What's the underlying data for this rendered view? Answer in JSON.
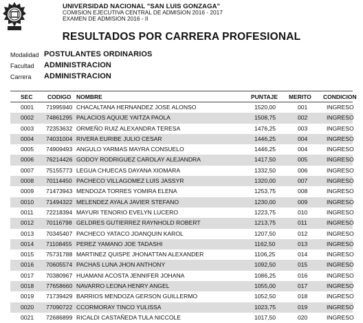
{
  "header": {
    "university": "UNIVERSIDAD NACIONAL \"SAN LUIS GONZAGA\"",
    "commission": "COMISION EJECUTIVA CENTRAL DE ADMISION 2016 - 2017",
    "exam": "EXAMEN DE ADMISION 2016 - II"
  },
  "title": "RESULTADOS POR CARRERA PROFESIONAL",
  "meta": {
    "modalidad_label": "Modalidad",
    "modalidad_value": "POSTULANTES ORDINARIOS",
    "facultad_label": "Facultad",
    "facultad_value": "ADMINISTRACION",
    "carrera_label": "Carrera",
    "carrera_value": "ADMINISTRACION"
  },
  "table": {
    "headers": [
      "SEC",
      "CODIGO",
      "NOMBRE",
      "PUNTAJE",
      "MERITO",
      "CONDICION"
    ],
    "rows": [
      [
        "0001",
        "71995940",
        "CHACALTANA HERNANDEZ JOSE ALONSO",
        "1520,00",
        "001",
        "INGRESO"
      ],
      [
        "0002",
        "74861295",
        "PALACIOS AQUIJE YAITZA PAOLA",
        "1508,75",
        "002",
        "INGRESO"
      ],
      [
        "0003",
        "72353632",
        "ORMEÑO RUIZ ALEXANDRA TERESA",
        "1476,25",
        "003",
        "INGRESO"
      ],
      [
        "0004",
        "74031004",
        "RIVERA EURIBE JULIO CESAR",
        "1446,25",
        "004",
        "INGRESO"
      ],
      [
        "0005",
        "74909493",
        "ANGULO YARMAS  MAYRA CONSUELO",
        "1446,25",
        "004",
        "INGRESO"
      ],
      [
        "0006",
        "76214426",
        "GODOY RODRIGUEZ CAROLAY ALEJANDRA",
        "1417,50",
        "005",
        "INGRESO"
      ],
      [
        "0007",
        "75155773",
        "LEGUA CHUECAS DAYANA XIOMARA",
        "1332,50",
        "006",
        "INGRESO"
      ],
      [
        "0008",
        "70114450",
        "PACHECO VILLAGOMEZ LUIS JASSYR",
        "1320,00",
        "007",
        "INGRESO"
      ],
      [
        "0009",
        "71473943",
        "MENDOZA TORRES  YOMIRA ELENA",
        "1253,75",
        "008",
        "INGRESO"
      ],
      [
        "0010",
        "71494322",
        "MELENDEZ AYALA JAVIER STEFANO",
        "1230,00",
        "009",
        "INGRESO"
      ],
      [
        "0011",
        "72218394",
        "MAYURI TENORIO EVELYN LUCERO",
        "1223,75",
        "010",
        "INGRESO"
      ],
      [
        "0012",
        "70116798",
        "GELDRES GUTIERREZ RAYNHOLD ROBERT",
        "1213,75",
        "011",
        "INGRESO"
      ],
      [
        "0013",
        "70345407",
        "PACHECO YATACO JOANQUIN KAROL",
        "1207,50",
        "012",
        "INGRESO"
      ],
      [
        "0014",
        "71108455",
        "PEREZ YAMANO JOE TADASHI",
        "1162,50",
        "013",
        "INGRESO"
      ],
      [
        "0015",
        "75731788",
        "MARTINEZ QUISPE JHONATTAN ALEXANDER",
        "1106,25",
        "014",
        "INGRESO"
      ],
      [
        "0016",
        "70605574",
        "PACHAS LUNA JHON ANTHONY",
        "1092,50",
        "015",
        "INGRESO"
      ],
      [
        "0017",
        "70380967",
        "HUAMANI ACOSTA JENNIFER JOHANA",
        "1086,25",
        "016",
        "INGRESO"
      ],
      [
        "0018",
        "77658660",
        "NAVARRO LEONA HENRY ANGEL",
        "1055,00",
        "017",
        "INGRESO"
      ],
      [
        "0019",
        "71739429",
        "BARRIOS  MENDOZA GERSON GUILLERMO",
        "1052,50",
        "018",
        "INGRESO"
      ],
      [
        "0020",
        "77090722",
        "CCORMORAY TINCO YULISSA",
        "1023,75",
        "019",
        "INGRESO"
      ],
      [
        "0021",
        "72686899",
        "RICALDI CASTAÑEDA TULA NICCOLE",
        "1017,50",
        "020",
        "INGRESO"
      ]
    ]
  }
}
